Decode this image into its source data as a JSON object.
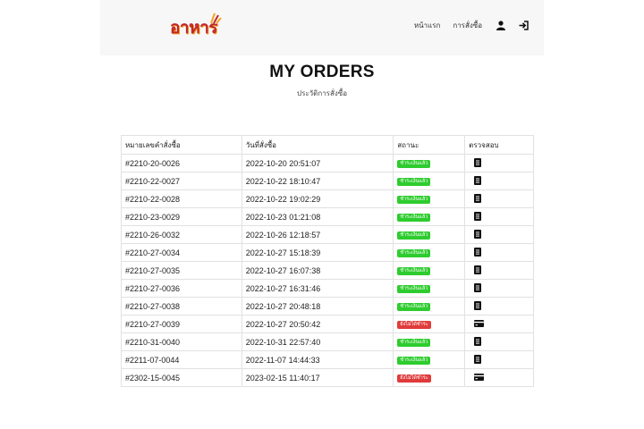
{
  "navbar": {
    "logo_text": "อาหาร",
    "links": [
      {
        "label": "หน้าแรก"
      },
      {
        "label": "การสั่งซื้อ"
      }
    ],
    "icons": [
      "user-icon",
      "sign-in-icon"
    ]
  },
  "page": {
    "title": "MY ORDERS",
    "subtitle": "ประวัติการสั่งซื้อ"
  },
  "table": {
    "headers": [
      "หมายเลขคำสั่งซื้อ",
      "วันที่สั่งซื้อ",
      "สถานะ",
      "ตรวจสอบ"
    ],
    "rows": [
      {
        "id": "#2210-20-0026",
        "date": "2022-10-20 20:51:07",
        "status": "ชำระเงินแล้ว",
        "action_icon": "receipt-icon"
      },
      {
        "id": "#2210-22-0027",
        "date": "2022-10-22 18:10:47",
        "status": "ชำระเงินแล้ว",
        "action_icon": "receipt-icon"
      },
      {
        "id": "#2210-22-0028",
        "date": "2022-10-22 19:02:29",
        "status": "ชำระเงินแล้ว",
        "action_icon": "receipt-icon"
      },
      {
        "id": "#2210-23-0029",
        "date": "2022-10-23 01:21:08",
        "status": "ชำระเงินแล้ว",
        "action_icon": "receipt-icon"
      },
      {
        "id": "#2210-26-0032",
        "date": "2022-10-26 12:18:57",
        "status": "ชำระเงินแล้ว",
        "action_icon": "receipt-icon"
      },
      {
        "id": "#2210-27-0034",
        "date": "2022-10-27 15:18:39",
        "status": "ชำระเงินแล้ว",
        "action_icon": "receipt-icon"
      },
      {
        "id": "#2210-27-0035",
        "date": "2022-10-27 16:07:38",
        "status": "ชำระเงินแล้ว",
        "action_icon": "receipt-icon"
      },
      {
        "id": "#2210-27-0036",
        "date": "2022-10-27 16:31:46",
        "status": "ชำระเงินแล้ว",
        "action_icon": "receipt-icon"
      },
      {
        "id": "#2210-27-0038",
        "date": "2022-10-27 20:48:18",
        "status": "ชำระเงินแล้ว",
        "action_icon": "receipt-icon"
      },
      {
        "id": "#2210-27-0039",
        "date": "2022-10-27 20:50:42",
        "status": "ยังไม่ได้ชำระ",
        "action_icon": "credit-card-icon"
      },
      {
        "id": "#2210-31-0040",
        "date": "2022-10-31 22:57:40",
        "status": "ชำระเงินแล้ว",
        "action_icon": "receipt-icon"
      },
      {
        "id": "#2211-07-0044",
        "date": "2022-11-07 14:44:33",
        "status": "ชำระเงินแล้ว",
        "action_icon": "receipt-icon"
      },
      {
        "id": "#2302-15-0045",
        "date": "2023-02-15 11:40:17",
        "status": "ยังไม่ได้ชำระ",
        "action_icon": "credit-card-icon"
      }
    ]
  },
  "colors": {
    "paid": "#2ecc2e",
    "unpaid": "#e03b3b",
    "logo_red": "#c0272d",
    "logo_orange": "#f6a21d",
    "navbar_bg": "#f7f7f8"
  }
}
